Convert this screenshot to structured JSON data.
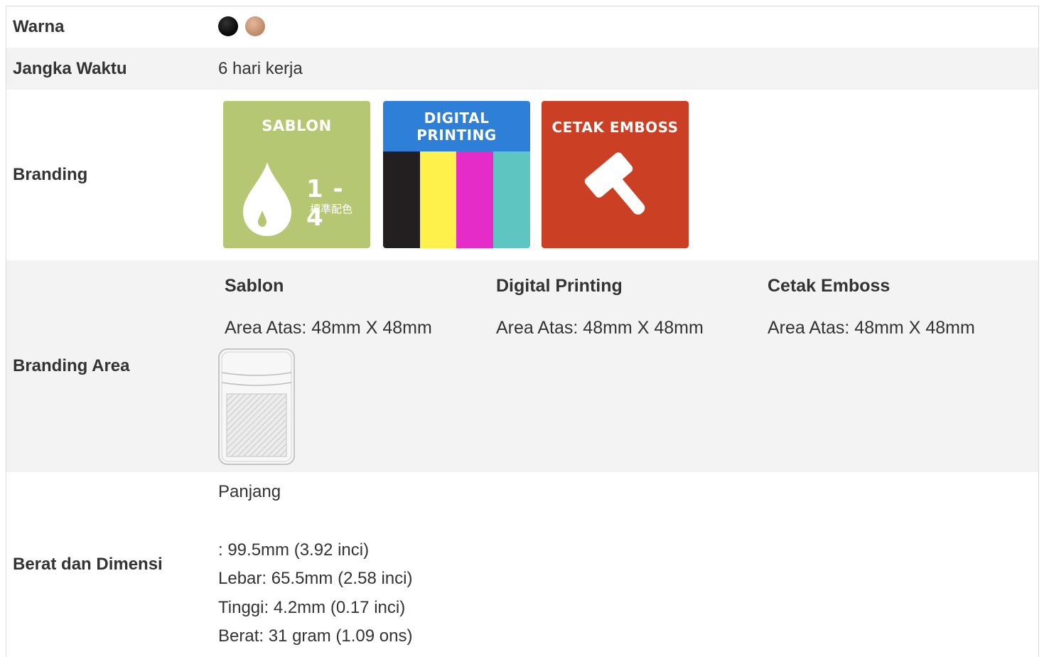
{
  "rows": {
    "warna": {
      "label": "Warna",
      "swatches": [
        {
          "name": "black",
          "color": "#0a0a0a"
        },
        {
          "name": "copper",
          "color": "#c99a7a"
        }
      ]
    },
    "jangka": {
      "label": "Jangka Waktu",
      "value": "6 hari kerja"
    },
    "branding": {
      "label": "Branding",
      "tiles": {
        "sablon": {
          "title": "SABLON",
          "count": "1 - 4",
          "sub": "標準配色",
          "color": "#b6c773"
        },
        "digital": {
          "title_line1": "DIGITAL",
          "title_line2": "PRINTING",
          "head_color": "#2e7fd8"
        },
        "emboss": {
          "title": "CETAK EMBOSS",
          "color": "#cb3f24"
        }
      }
    },
    "area": {
      "label": "Branding Area",
      "columns": [
        {
          "title": "Sablon",
          "text": "Area Atas: 48mm X 48mm"
        },
        {
          "title": "Digital Printing",
          "text": "Area Atas: 48mm X 48mm"
        },
        {
          "title": "Cetak Emboss",
          "text": "Area Atas: 48mm X 48mm"
        }
      ]
    },
    "dimensi": {
      "label": "Berat dan Dimensi",
      "panjang": "Panjang",
      "panjang_value": ": 99.5mm (3.92 inci)",
      "lebar": "Lebar: 65.5mm (2.58 inci)",
      "tinggi": "Tinggi: 4.2mm (0.17 inci)",
      "berat": "Berat: 31 gram (1.09 ons)"
    }
  }
}
